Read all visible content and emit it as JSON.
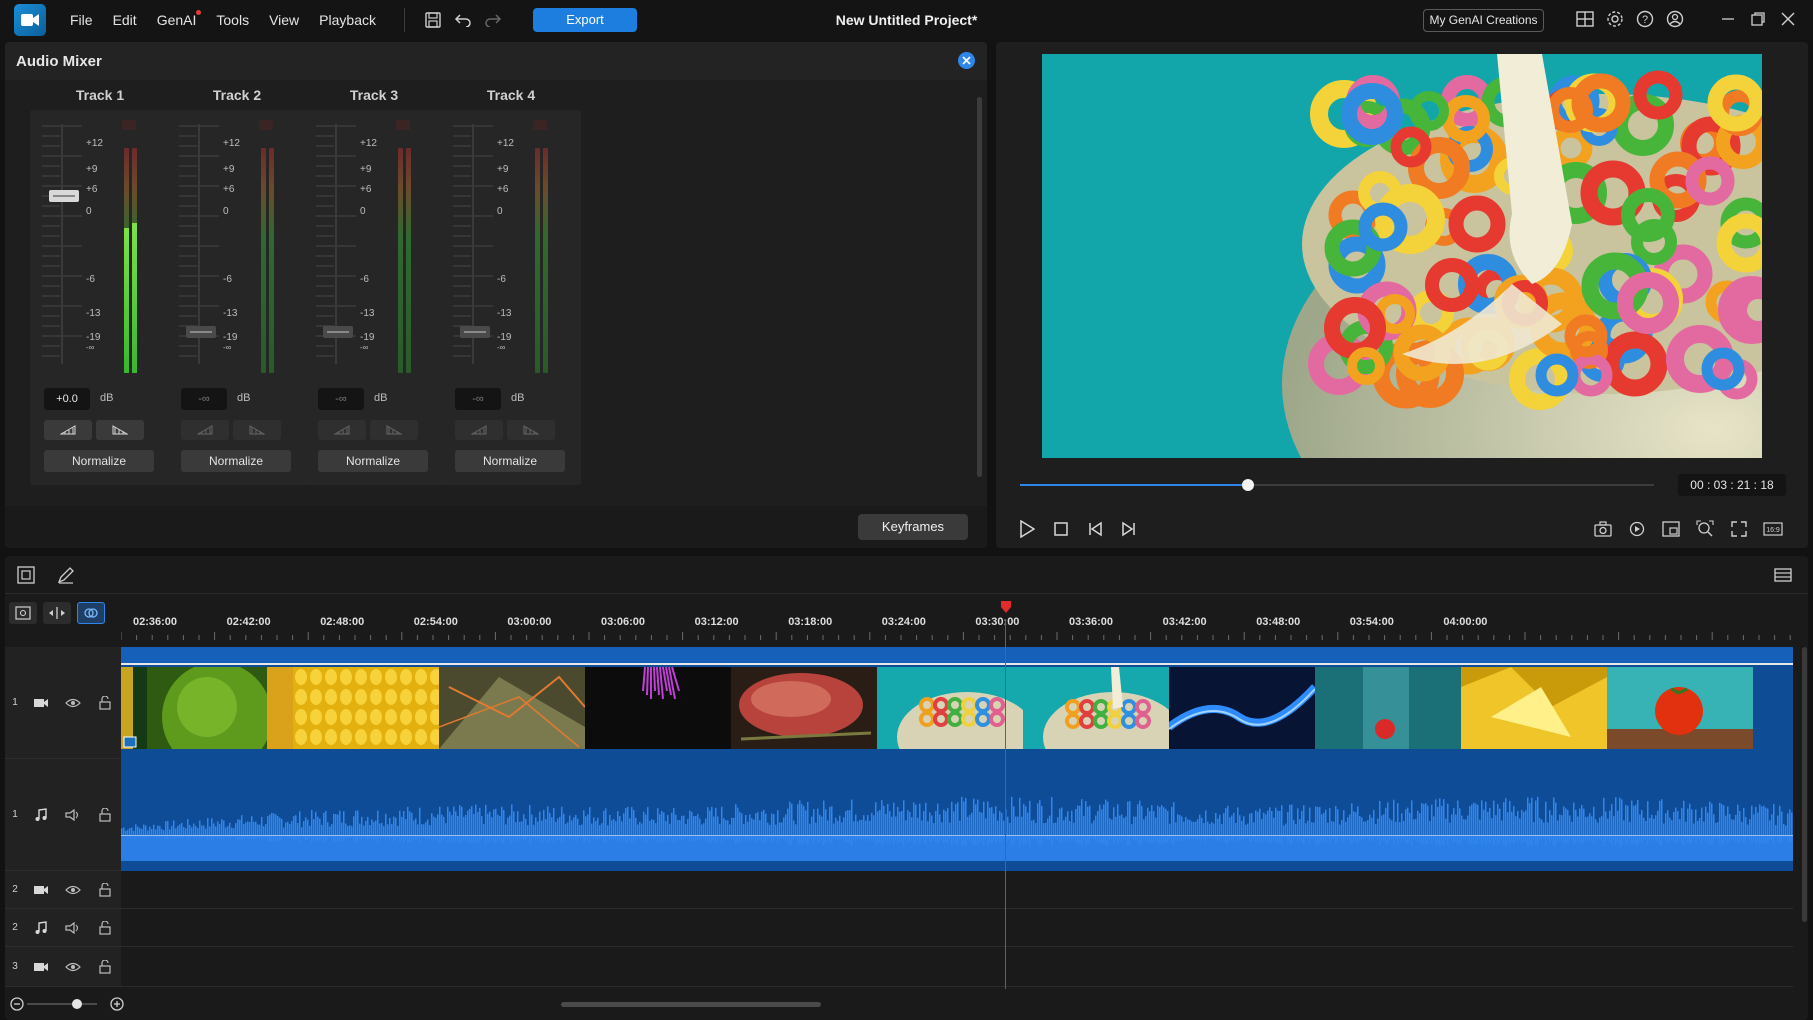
{
  "app": {
    "project_title": "New Untitled Project*",
    "menu": [
      "File",
      "Edit",
      "GenAI",
      "Tools",
      "View",
      "Playback"
    ],
    "export_label": "Export",
    "genai_button": "My GenAI Creations"
  },
  "mixer": {
    "title": "Audio Mixer",
    "scale_labels": [
      "+12",
      "+9",
      "+6",
      "0",
      "-6",
      "-13",
      "-19",
      "-∞"
    ],
    "unit": "dB",
    "normalize_label": "Normalize",
    "keyframes_label": "Keyframes",
    "tracks": [
      {
        "name": "Track 1",
        "value": "+0.0",
        "fader_level_db": 0,
        "active": true
      },
      {
        "name": "Track 2",
        "value": "-∞",
        "fader_level_db": "-∞",
        "active": false
      },
      {
        "name": "Track 3",
        "value": "-∞",
        "fader_level_db": "-∞",
        "active": false
      },
      {
        "name": "Track 4",
        "value": "-∞",
        "fader_level_db": "-∞",
        "active": false
      }
    ]
  },
  "preview": {
    "timecode": "00 : 03 : 21 : 18",
    "playback_progress": 0.36
  },
  "timeline": {
    "ruler": [
      "02:36:00",
      "02:42:00",
      "02:48:00",
      "02:54:00",
      "03:00:00",
      "03:06:00",
      "03:12:00",
      "03:18:00",
      "03:24:00",
      "03:30:00",
      "03:36:00",
      "03:42:00",
      "03:48:00",
      "03:54:00",
      "04:00:00"
    ],
    "track_headers": [
      {
        "num": "1",
        "type": "video"
      },
      {
        "num": "1",
        "type": "audio"
      },
      {
        "num": "2",
        "type": "video"
      },
      {
        "num": "2",
        "type": "audio"
      },
      {
        "num": "3",
        "type": "video"
      }
    ],
    "clips": [
      "lime",
      "corn",
      "geometric",
      "purple-fiber",
      "steak",
      "cereal",
      "cereal-milk",
      "blue-fire",
      "strawberry-glass",
      "gold-foil",
      "tomato"
    ]
  }
}
